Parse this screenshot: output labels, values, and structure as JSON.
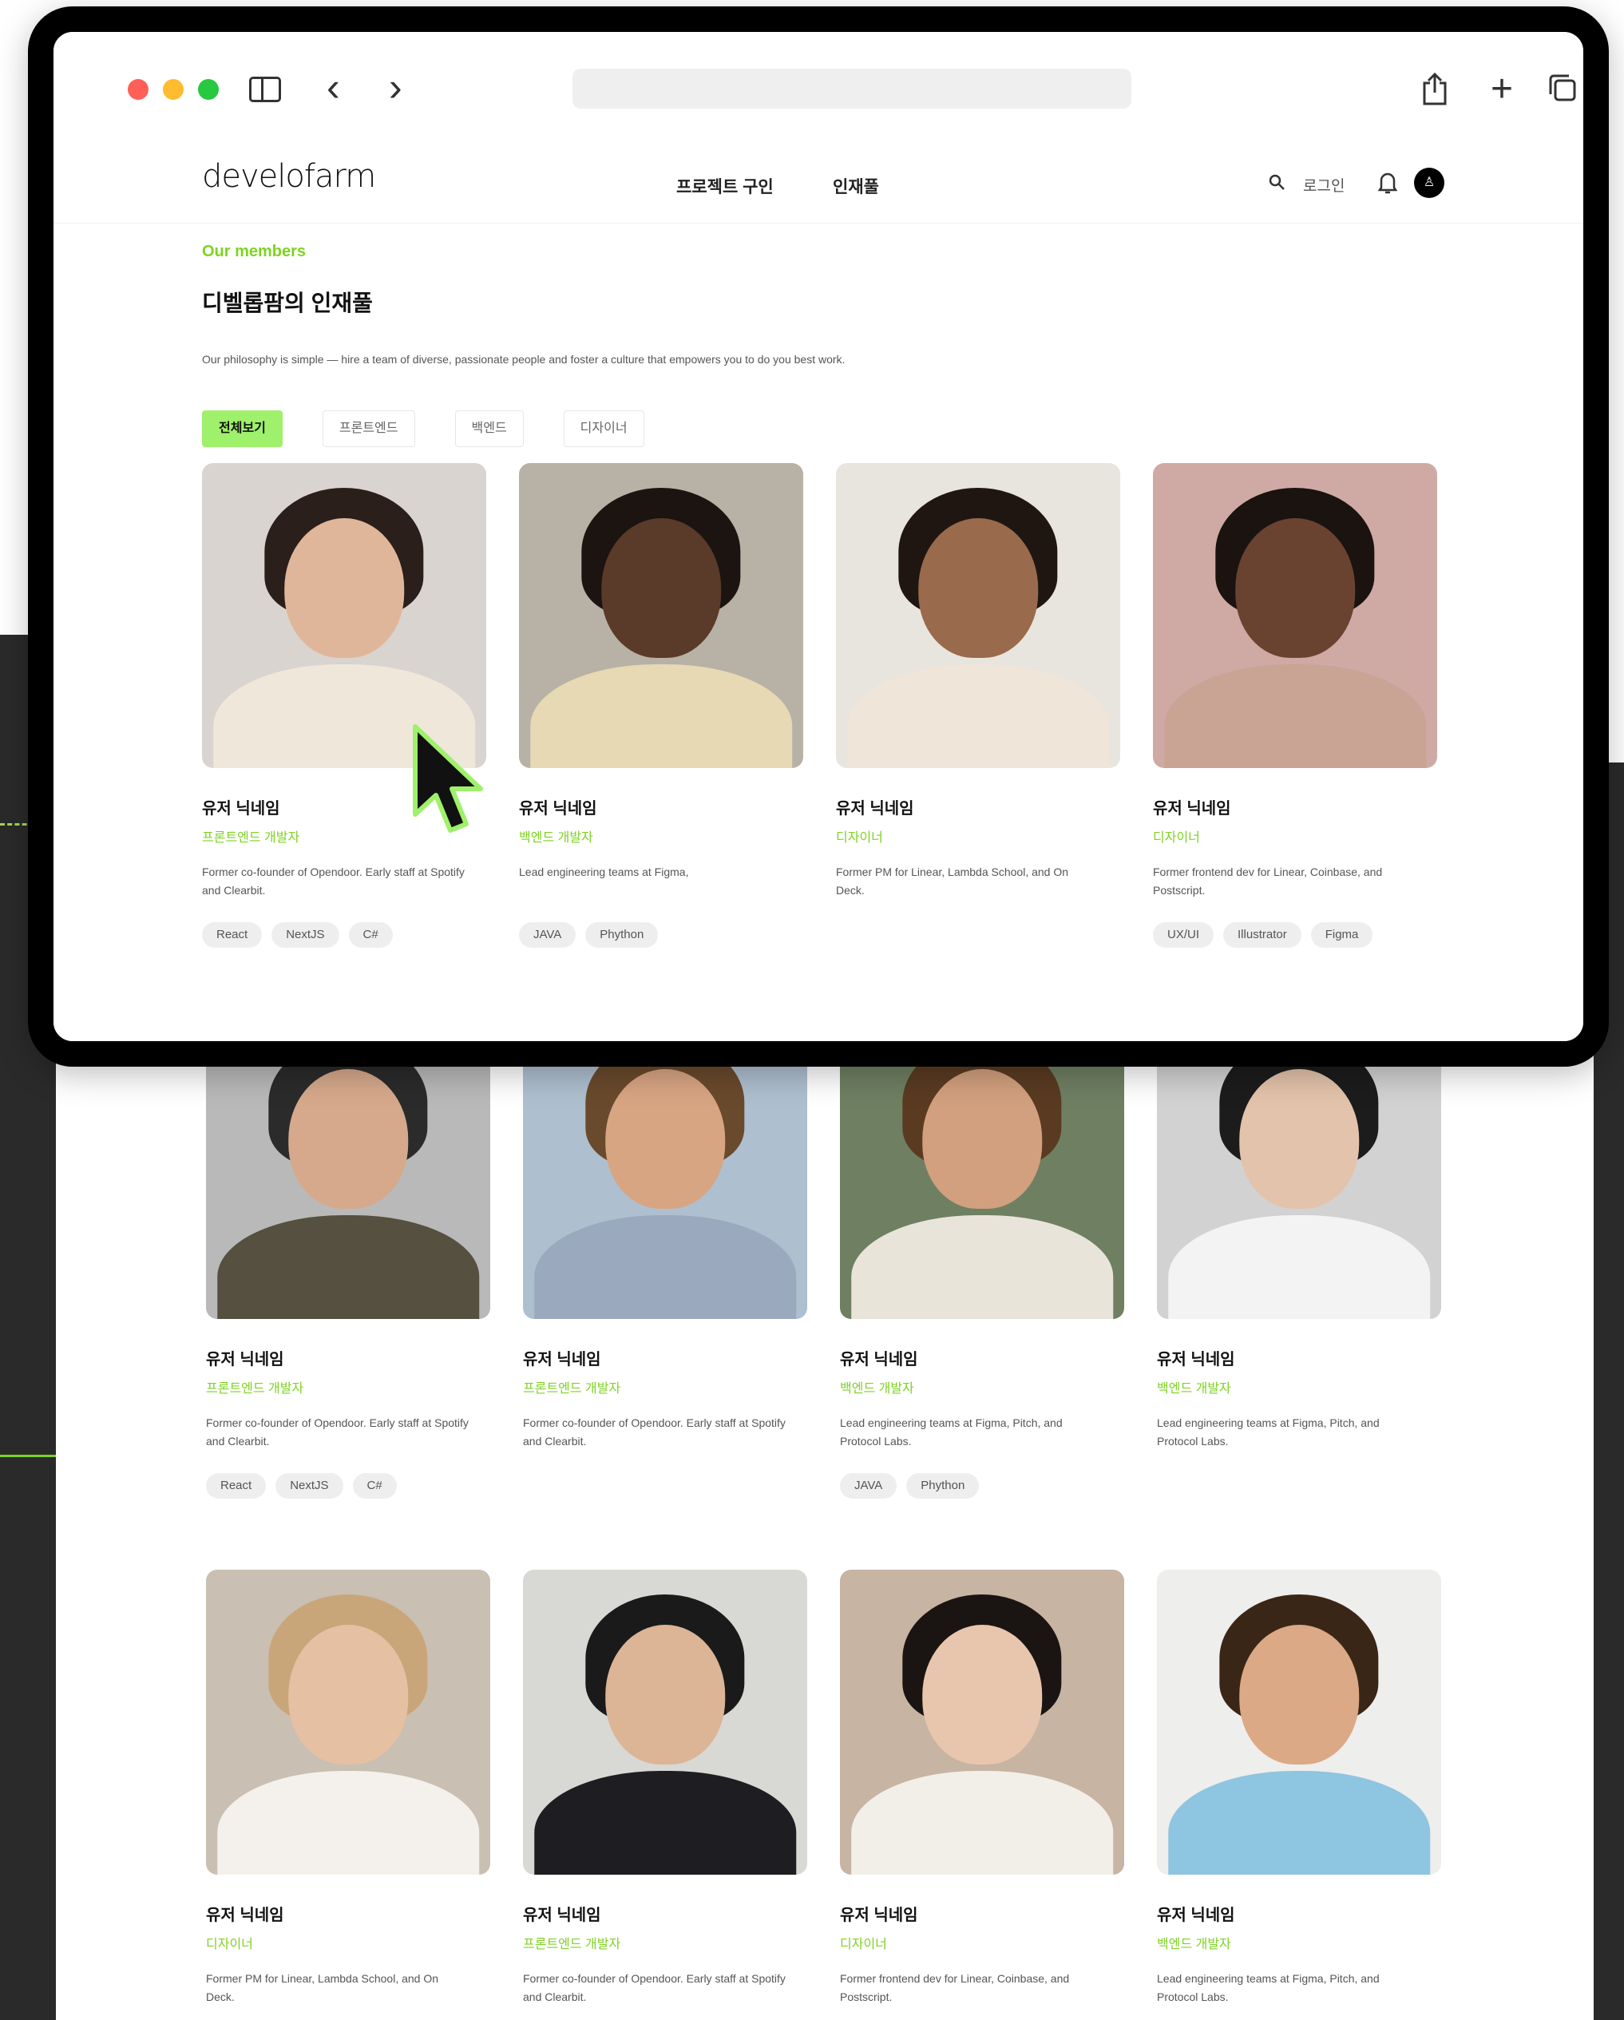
{
  "browser": {
    "chrome_icons": [
      "sidebar-icon",
      "chevron-left-icon",
      "chevron-right-icon",
      "share-icon",
      "plus-icon",
      "tabs-icon"
    ],
    "back_label": "‹",
    "forward_label": "›",
    "new_tab_label": "+"
  },
  "header": {
    "logo_text": "develofarm",
    "nav": [
      "프로젝트 구인",
      "인재풀"
    ],
    "login_label": "로그인",
    "avatar_glyph": "♙"
  },
  "intro": {
    "eyebrow": "Our members",
    "title": "디벨롭팜의 인재풀",
    "lead": "Our philosophy is simple — hire a team of diverse, passionate people and foster a culture that empowers you to do you best work."
  },
  "filters": [
    "전체보기",
    "프론트엔드",
    "백엔드",
    "디자이너"
  ],
  "members": [
    {
      "name": "유저 닉네임",
      "role": "프론트엔드 개발자",
      "bio": "Former co-founder of Opendoor. Early staff at Spotify and Clearbit.",
      "tags": [
        "React",
        "NextJS",
        "C#"
      ]
    },
    {
      "name": "유저 닉네임",
      "role": "백엔드 개발자",
      "bio": "Lead engineering teams at Figma,",
      "tags": [
        "JAVA",
        "Phython"
      ]
    },
    {
      "name": "유저 닉네임",
      "role": "디자이너",
      "bio": "Former PM for Linear, Lambda School, and On Deck.",
      "tags": []
    },
    {
      "name": "유저 닉네임",
      "role": "디자이너",
      "bio": "Former frontend dev for Linear, Coinbase, and Postscript.",
      "tags": [
        "UX/UI",
        "Illustrator",
        "Figma"
      ]
    },
    {
      "name": "유저 닉네임",
      "role": "프론트엔드 개발자",
      "bio": "Former co-founder of Opendoor. Early staff at Spotify and Clearbit.",
      "tags": [
        "React",
        "NextJS",
        "C#"
      ]
    },
    {
      "name": "유저 닉네임",
      "role": "프론트엔드 개발자",
      "bio": "Former co-founder of Opendoor. Early staff at Spotify and Clearbit.",
      "tags": []
    },
    {
      "name": "유저 닉네임",
      "role": "백엔드 개발자",
      "bio": "Lead engineering teams at Figma, Pitch, and Protocol Labs.",
      "tags": [
        "JAVA",
        "Phython"
      ]
    },
    {
      "name": "유저 닉네임",
      "role": "백엔드 개발자",
      "bio": "Lead engineering teams at Figma, Pitch, and Protocol Labs.",
      "tags": []
    },
    {
      "name": "유저 닉네임",
      "role": "디자이너",
      "bio": "Former PM for Linear, Lambda School, and On Deck.",
      "tags": []
    },
    {
      "name": "유저 닉네임",
      "role": "프론트엔드 개발자",
      "bio": "Former co-founder of Opendoor. Early staff at Spotify and Clearbit.",
      "tags": []
    },
    {
      "name": "유저 닉네임",
      "role": "디자이너",
      "bio": "Former frontend dev for Linear, Coinbase, and Postscript.",
      "tags": []
    },
    {
      "name": "유저 닉네임",
      "role": "백엔드 개발자",
      "bio": "Lead engineering teams at Figma, Pitch, and Protocol Labs.",
      "tags": []
    }
  ],
  "colors": {
    "accent": "#7ed321",
    "active_filter": "#9ff06a",
    "frame": "#000000",
    "backdrop": "#2a2a2a"
  }
}
